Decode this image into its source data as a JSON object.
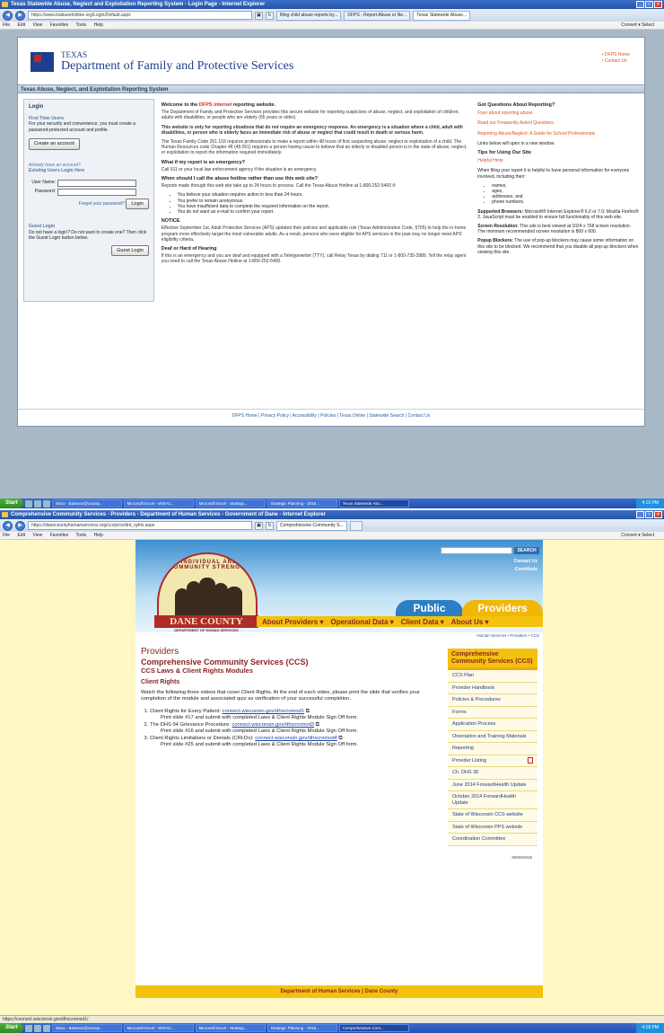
{
  "s1": {
    "window_title": "Texas Statewide Abuse, Neglect and Exploitation Reporting System - Login Page - Internet Explorer",
    "url": "https://www.txabusehotline.org/Login/Default.aspx",
    "tabs": [
      "filing child abuse reports by...",
      "DFPS - Report Abuse or Ne...",
      "Texas Statewide Abuse..."
    ],
    "menu": [
      "File",
      "Edit",
      "View",
      "Favorites",
      "Tools",
      "Help"
    ],
    "menu_right": "Convert ▾  Select",
    "agency_line1": "TEXAS",
    "agency_line2": "Department of Family and Protective Services",
    "top_links": [
      "• DFPS Home",
      "• Contact Us"
    ],
    "system_bar": "Texas Abuse, Neglect, and Exploitation Reporting System",
    "login": {
      "heading": "Login",
      "first_time": "First Time Users",
      "first_time_text": "For your security and convenience, you must create a password-protected account and profile.",
      "create_btn": "Create an account",
      "existing_q": "Already have an account?",
      "existing_h": "Existing Users Login Here",
      "user_label": "User Name:",
      "password_label": "Password:",
      "forgot": "Forgot your password?",
      "login_btn": "Login",
      "guest_h": "Guest Login",
      "guest_text": "Do not have a login? Do not want to create one? Then click the Guest Login button below.",
      "guest_btn": "Guest Login"
    },
    "main": {
      "welcome_pre": "Welcome to the ",
      "welcome_red": "DFPS internet",
      "welcome_post": " reporting website.",
      "p1": "The Department of Family and Protective Services provides this secure website for reporting suspicions of abuse, neglect, and exploitation of children, adults with disabilities, or people who are elderly (65 years or older).",
      "p2": "This website is only for reporting situations that do not require an emergency response. An emergency is a situation where a child, adult with disabilities, or person who is elderly faces an immediate risk of abuse or neglect that could result in death or serious harm.",
      "p3": "The Texas Family Code 261.103 requires professionals to make a report within 48 hours of first suspecting abuse, neglect or exploitation of a child. The Human Resources code Chapter 48 (48.051) requires a person having cause to believe that an elderly or disabled person is in the state of abuse, neglect, or exploitation to report the information required immediately.",
      "h_emergency": "What if my report is an emergency?",
      "p4": "Call 911 or your local law enforcement agency if the situation is an emergency.",
      "h_hotline": "When should I call the abuse hotline rather than use this web site?",
      "p5": "Reports made through this web site take up to 24 hours to process. Call the Texas Abuse Hotline at 1-800-252-5400 if:",
      "bullets": [
        "You believe your situation requires action in less than 24 hours.",
        "You prefer to remain anonymous.",
        "You have insufficient data to complete the required information on the report.",
        "You do not want an e-mail to confirm your report."
      ],
      "h_notice": "NOTICE",
      "p6": "Effective September 1st, Adult Protective Services (APS) updated their policies and applicable rule (Texas Administrative Code, §705) to help the in-home program more effectively target the most vulnerable adults. As a result, persons who were eligible for APS services in the past may no longer meet APS' eligibility criteria.",
      "h_deaf": "Deaf or Hard of Hearing",
      "p7": "If this is an emergency and you are deaf and equipped with a Teletypewriter (TTY), call Relay Texas by dialing 711 or 1-800-735-2989. Tell the relay agent you need to call the Texas Abuse Hotline at 1-800-252-5400."
    },
    "right": {
      "h1": "Got Questions About Reporting?",
      "links": [
        "Flyer about reporting abuse",
        "Read our Frequently Asked Questions.",
        "Reporting Abuse/Neglect: A Guide for School Professionals"
      ],
      "note": "Links below will open in a new window.",
      "h2": "Tips for Using Our Site",
      "hints": "Helpful Hints",
      "p1": "When filing your report it is helpful to have personal information for everyone involved, including their:",
      "list": [
        "names,",
        "ages,",
        "addresses, and",
        "phone numbers."
      ],
      "browsers_b": "Supported Browsers:",
      "browsers": " Microsoft® Internet Explorer® 6.0 or 7.0; Mozilla Firefox® 2. JavaScript must be enabled to ensure full functionality of this web site.",
      "res_b": "Screen Resolution:",
      "res": " This site is best viewed at 1024 x 768 screen resolution. The minimum recommended screen resolution is 800 x 600.",
      "popup_b": "Popup Blockers:",
      "popup": " The use of pop-up blockers may cause some information on this site to be blocked. We recommend that you disable all pop-up blockers when viewing this site."
    },
    "footer": "DFPS Home | Privacy Policy | Accessibility | Policies | Texas Online | Statewide Search | Contact Us",
    "taskbar": {
      "start": "Start",
      "items": [
        "Inbox - Bastean@county...",
        "Microsoft Excel - WISAC...",
        "Microsoft Excel - Strategi...",
        "Strategic Planning - 2016...",
        "Texas Statewide Abu..."
      ],
      "clock": "4:10 PM"
    }
  },
  "s2": {
    "window_title": "Comprehensive Community Services - Providers - Department of Human Services - Government of Dane - Internet Explorer",
    "url": "https://danecountyhumanservices.org/ccs/prov/dnt_rghts.aspx",
    "tab": "Comprehensive Community S...",
    "menu": [
      "File",
      "Edit",
      "View",
      "Favorites",
      "Tools",
      "Help"
    ],
    "menu_right": "Convert ▾  Select",
    "search_btn": "SEARCH",
    "contact": "Contact Us",
    "contribute": "Contribute",
    "seal_text": "INDIVIDUAL AND COMMUNITY STRENGTH",
    "dane_name": "DANE COUNTY",
    "dane_sub": "DEPARTMENT OF HUMAN SERVICES",
    "tab_public": "Public",
    "tab_providers": "Providers",
    "nav": [
      "About Providers ▾",
      "Operational Data ▾",
      "Client Data ▾",
      "About Us ▾"
    ],
    "crumb": "Human Services  •  Providers  •  CCS",
    "h_providers": "Providers",
    "h_ccs": "Comprehensive Community Services (CCS)",
    "h_laws": "CCS Laws & Client Rights Modules",
    "h_rights": "Client Rights",
    "intro": "Watch the following three videos that cover Client Rights. At the end of each video, please print the slide that verifies your completion of the module and associated quiz as verification of your successful completion.",
    "items": [
      {
        "label": "Client Rights for Every Patient: ",
        "link": "connect.wisconsin.gov/dhscromod1",
        "sub": "Print slide #17 and submit with completed Laws & Client Rights Module Sign Off form."
      },
      {
        "label": "The DHS 94 Grievance Procedure: ",
        "link": "connect.wisconsin.gov/dhscromod3",
        "sub": "Print slide #16 and submit with completed Laws & Client Rights Module Sign Off form."
      },
      {
        "label": "Client Rights Limitations or Denials (CRLDs): ",
        "link": "connect.wisconsin.gov/dhscromod4",
        "sub": "Print slide #25 and submit with completed Laws & Client Rights Module Sign Off form."
      }
    ],
    "side_heading": "Comprehensive Community Services (CCS)",
    "side_items": [
      "CCS Plan",
      "Provider Handbook",
      "Policies & Procedures",
      "Forms",
      "Application Process",
      "Orientation and Training Materials",
      "Reporting",
      "Provider Listing",
      "Ch. DHS 36",
      "June 2014 ForwardHealth Update",
      "October 2014 ForwardHealth Update",
      "State of Wisconsin CCS website",
      "State of Wisconsin PPS website",
      "Coordination Committee"
    ],
    "date": "09/09/2015",
    "footer": "Department of Human Services  |  Dane County",
    "status_url": "https://connect.wisconsin.gov/dhscromod1/",
    "taskbar": {
      "start": "Start",
      "items": [
        "Inbox - Bastean@county...",
        "Microsoft Excel - WISAC...",
        "Microsoft Excel - Strategi...",
        "Strategic Planning - 2016...",
        "Comprehensive Com..."
      ],
      "clock": "4:18 PM"
    },
    "colors": {
      "brand_red": "#8b2323",
      "brand_yellow": "#f2c20f",
      "link_blue": "#1a45a8"
    }
  }
}
